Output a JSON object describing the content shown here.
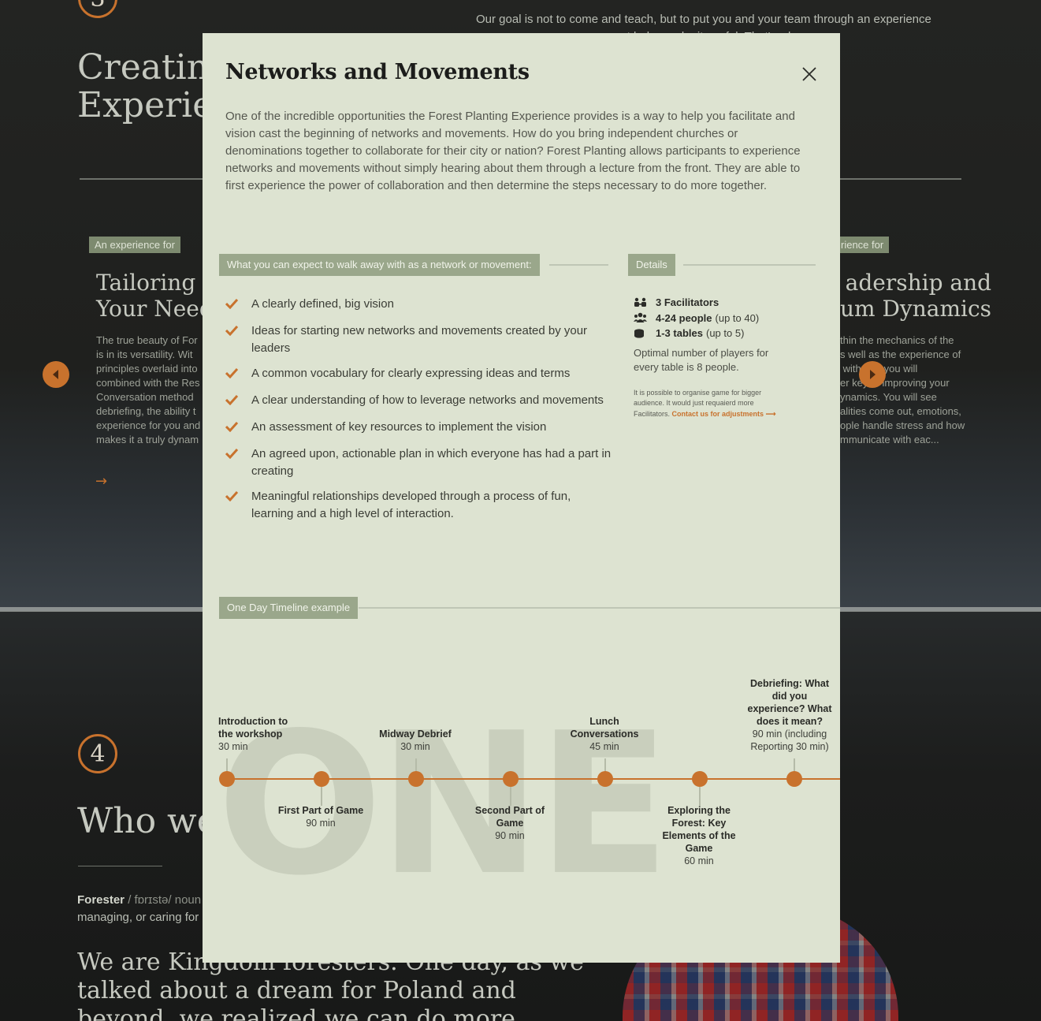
{
  "background": {
    "step3_number": "3",
    "step3_heading": "Creating t\nExperien",
    "step3_para": "Our goal is not to come and teach, but to put you and your team through an experience\n                                              t helps make it useful. That's why\n                                              he training process\n\n                                              reas of needs in order",
    "card_left": {
      "tag": "An experience for",
      "title": "Tailoring t\nYour Need",
      "text": "The true beauty of For\nis in its versatility. Wit\nprinciples overlaid into\ncombined with the Res\nConversation method\ndebriefing, the ability t\nexperience for you and\nmakes it a truly dynam"
    },
    "card_right": {
      "tag": "rience for",
      "title": "adership and\num Dynamics",
      "text": "thin the mechanics of the\ns well as the experience of\n with    rs you will\ner key     improving your\nynamics. You will see\nalities come out, emotions,\nople handle stress and how\nmmunicate with eac..."
    },
    "step4_number": "4",
    "step4_heading": "Who we",
    "forester_word": "Forester",
    "forester_rest": " / fɒrɪstə/ noun",
    "forester_line2": "managing, or caring for",
    "big_text": "We are Kingdom foresters. One day, as we\ntalked about a dream for Poland and\nbeyond, we realized we can do more"
  },
  "modal": {
    "title": "Networks and Movements",
    "intro": "One of the incredible opportunities the Forest Planting Experience provides is a way to help you facilitate and vision cast the beginning of networks and movements. How do you bring independent churches or denominations together to collaborate for their city or nation? Forest Planting allows participants to experience networks and movements without simply hearing about them through a lecture from the front. They are able to first experience the power of collaboration and then determine the steps necessary to do more together.",
    "benefits_tag": "What you can expect to walk away with as a network or movement:",
    "benefits": [
      "A clearly defined, big vision",
      "Ideas for starting new networks and movements created by your leaders",
      "A common vocabulary for clearly expressing ideas and terms",
      "A clear understanding of how to leverage networks and movements",
      "An assessment of key resources to implement the vision",
      "An agreed upon, actionable plan in which everyone has had a part in creating",
      "Meaningful relationships developed through a process of fun, learning and a high level of interaction."
    ],
    "details_tag": "Details",
    "details": {
      "facilitators": "3 Facilitators",
      "people_bold": "4-24 people",
      "people_rest": "(up to 40)",
      "tables_bold": "1-3 tables",
      "tables_rest": "(up to 5)",
      "optimal": "Optimal number of players for every table is 8 people.",
      "small_note": "It is possible to organise game for bigger audience. It would just requaierd more Facilitators.",
      "contact_link": "Contact us for adjustments"
    },
    "timeline_tag": "One Day Timeline example",
    "timeline_bg_word": "ONE",
    "timeline": [
      {
        "title": "Introduction to the workshop",
        "duration": "30 min",
        "side": "top"
      },
      {
        "title": "First Part of Game",
        "duration": "90 min",
        "side": "bottom"
      },
      {
        "title": "Midway Debrief",
        "duration": "30 min",
        "side": "top"
      },
      {
        "title": "Second Part of Game",
        "duration": "90 min",
        "side": "bottom"
      },
      {
        "title": "Lunch Conversations",
        "duration": "45 min",
        "side": "top"
      },
      {
        "title": "Exploring the Forest: Key Elements of the Game",
        "duration": "60 min",
        "side": "bottom"
      },
      {
        "title": "Debriefing: What did you experience? What does it mean?",
        "duration": "90 min (including Reporting 30 min)",
        "side": "top"
      }
    ]
  }
}
